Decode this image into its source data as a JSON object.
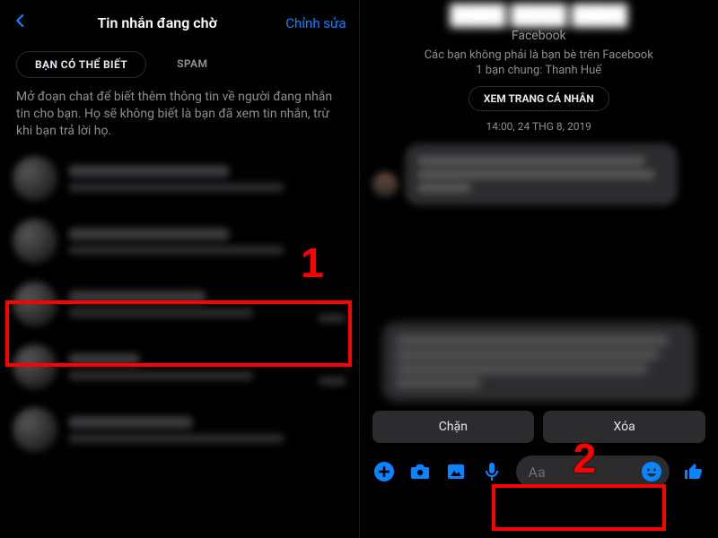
{
  "colors": {
    "accent": "#0a84ff",
    "danger": "#ff0000",
    "bg": "#000000",
    "muted": "#8e8e93"
  },
  "left": {
    "title": "Tin nhắn đang chờ",
    "edit": "Chỉnh sửa",
    "tabs": {
      "active": "BẠN CÓ THỂ BIẾT",
      "spam": "SPAM"
    },
    "instructions": "Mở đoạn chat để biết thêm thông tin về người đang nhắn tin cho bạn. Họ sẽ không biết là bạn đã xem tin nhắn, trừ khi bạn trả lời họ.",
    "rows": [
      {
        "blurred": true
      },
      {
        "blurred": true
      },
      {
        "blurred": true,
        "highlighted": true
      },
      {
        "blurred": true
      },
      {
        "blurred": true
      }
    ]
  },
  "right": {
    "name_blurred": "████ ████ ████",
    "platform": "Facebook",
    "not_friends": "Các bạn không phải là bạn bè trên Facebook",
    "mutual": "1 bạn chung: Thanh Huế",
    "view_profile": "XEM TRANG CÁ NHÂN",
    "timestamp": "14:00, 24 THG 8, 2019",
    "actions": {
      "block": "Chặn",
      "delete": "Xóa"
    },
    "composer": {
      "placeholder": "Aa",
      "icons": [
        "plus",
        "camera",
        "gallery",
        "mic",
        "emoji",
        "like"
      ]
    }
  },
  "annotations": {
    "marker1": "1",
    "marker2": "2"
  }
}
